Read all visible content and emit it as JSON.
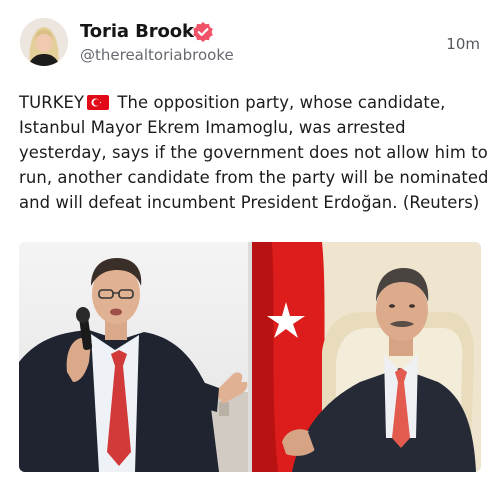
{
  "post": {
    "author_name": "Toria Brooke",
    "handle": "@therealtoriabrooke",
    "timestamp": "10m",
    "text_prefix": "TURKEY",
    "text_body": "The opposition party, whose candidate, Istanbul Mayor Ekrem Imamoglu, was arrested yesterday, says if the government does not allow him to run, another candidate from the party will be nominated and will defeat incumbent President Erdoğan. (Reuters)",
    "inline_icon": "turkey-flag-emoji"
  },
  "media": {
    "images": [
      {
        "name": "photo-imamoglu",
        "description_icon": "speaker-with-microphone"
      },
      {
        "name": "photo-erdogan",
        "description_icon": "seated-man-with-turkish-flag"
      }
    ]
  },
  "colors": {
    "verified_badge": "#f25268",
    "handle": "#666a70",
    "flag_red": "#e30a17",
    "tie_red": "#d23a3a"
  }
}
